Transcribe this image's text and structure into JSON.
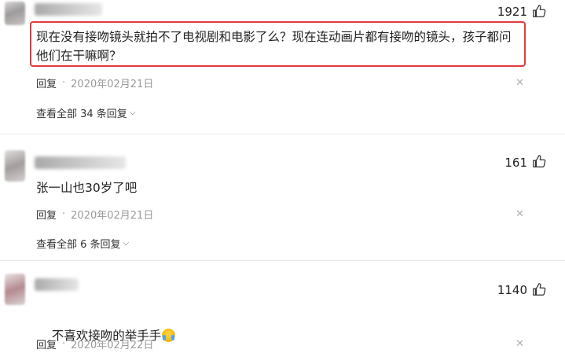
{
  "comments": [
    {
      "likes": "1921",
      "content": "现在没有接吻镜头就拍不了电视剧和电影了么？现在连动画片都有接吻的镜头，孩子都问\n他们在干嘛啊？",
      "reply_label": "回复",
      "date": "2020年02月21日",
      "view_all": "查看全部 34 条回复",
      "highlighted": true
    },
    {
      "likes": "161",
      "content": "张一山也30岁了吧",
      "reply_label": "回复",
      "date": "2020年02月21日",
      "view_all": "查看全部 6 条回复",
      "highlighted": false
    },
    {
      "likes": "1140",
      "content": "不喜欢接吻的举手手",
      "reply_label": "回复",
      "date": "2020年02月22日",
      "emoji": "crying-laughing-emoji",
      "highlighted": false
    }
  ],
  "colors": {
    "highlight": "#e4393c",
    "date": "#9a9a9a",
    "divider": "#e8e8e8"
  },
  "icons": {
    "like": "thumbs-up-icon",
    "close": "close-icon",
    "expand": "chevron-down-icon"
  }
}
